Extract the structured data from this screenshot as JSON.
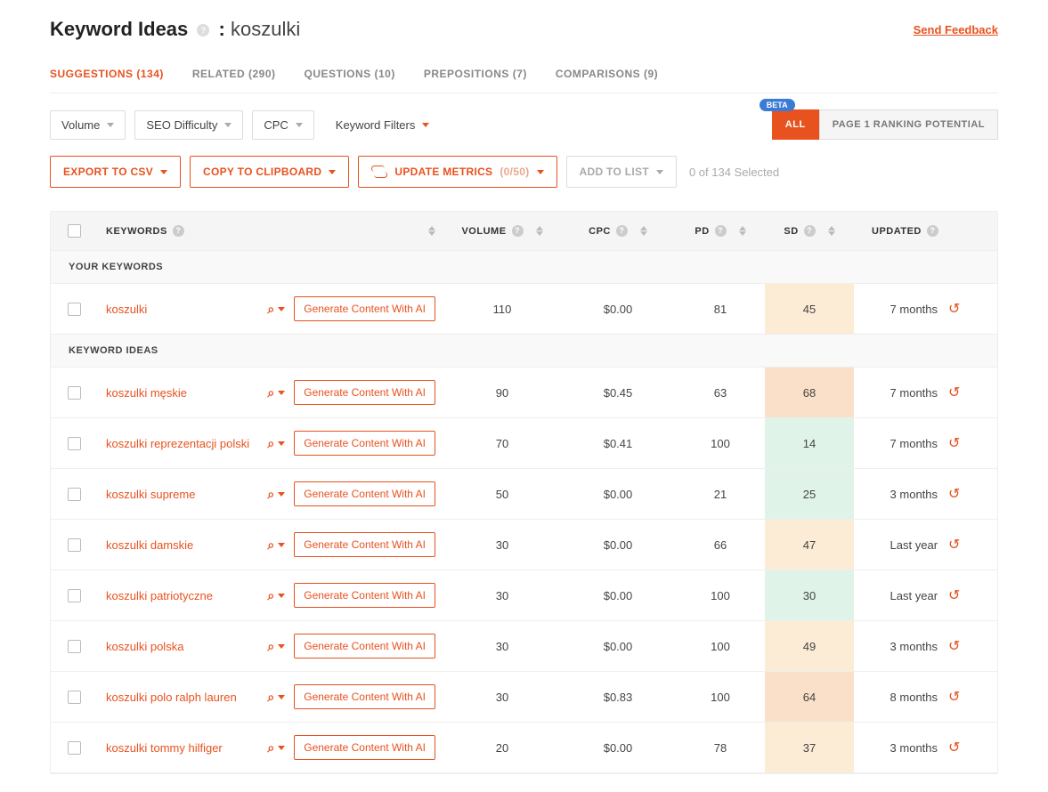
{
  "header": {
    "title_prefix": "Keyword Ideas",
    "keyword": "koszulki",
    "feedback": "Send Feedback"
  },
  "tabs": [
    {
      "label": "SUGGESTIONS (134)",
      "active": true
    },
    {
      "label": "RELATED (290)",
      "active": false
    },
    {
      "label": "QUESTIONS (10)",
      "active": false
    },
    {
      "label": "PREPOSITIONS (7)",
      "active": false
    },
    {
      "label": "COMPARISONS (9)",
      "active": false
    }
  ],
  "filters": {
    "volume": "Volume",
    "seo": "SEO Difficulty",
    "cpc": "CPC",
    "kw_filters": "Keyword Filters",
    "beta": "BETA",
    "all": "ALL",
    "potential": "PAGE 1 RANKING POTENTIAL"
  },
  "actions": {
    "export": "EXPORT TO CSV",
    "copy": "COPY TO CLIPBOARD",
    "update_prefix": "UPDATE METRICS",
    "update_count": "(0/50)",
    "add": "ADD TO LIST",
    "selected": "0 of 134 Selected"
  },
  "columns": {
    "keywords": "KEYWORDS",
    "volume": "VOLUME",
    "cpc": "CPC",
    "pd": "PD",
    "sd": "SD",
    "updated": "UPDATED"
  },
  "sections": {
    "your": "YOUR KEYWORDS",
    "ideas": "KEYWORD IDEAS"
  },
  "gen_label": "Generate Content With AI",
  "rows_your": [
    {
      "kw": "koszulki",
      "vol": "110",
      "cpc": "$0.00",
      "pd": "81",
      "sd": "45",
      "sd_color": "sd-yellow",
      "updated": "7 months"
    }
  ],
  "rows_ideas": [
    {
      "kw": "koszulki męskie",
      "vol": "90",
      "cpc": "$0.45",
      "pd": "63",
      "sd": "68",
      "sd_color": "sd-orange",
      "updated": "7 months"
    },
    {
      "kw": "koszulki reprezentacji polski",
      "vol": "70",
      "cpc": "$0.41",
      "pd": "100",
      "sd": "14",
      "sd_color": "sd-green",
      "updated": "7 months"
    },
    {
      "kw": "koszulki supreme",
      "vol": "50",
      "cpc": "$0.00",
      "pd": "21",
      "sd": "25",
      "sd_color": "sd-green",
      "updated": "3 months"
    },
    {
      "kw": "koszulki damskie",
      "vol": "30",
      "cpc": "$0.00",
      "pd": "66",
      "sd": "47",
      "sd_color": "sd-yellow",
      "updated": "Last year"
    },
    {
      "kw": "koszulki patriotyczne",
      "vol": "30",
      "cpc": "$0.00",
      "pd": "100",
      "sd": "30",
      "sd_color": "sd-green",
      "updated": "Last year"
    },
    {
      "kw": "koszulki polska",
      "vol": "30",
      "cpc": "$0.00",
      "pd": "100",
      "sd": "49",
      "sd_color": "sd-yellow",
      "updated": "3 months"
    },
    {
      "kw": "koszulki polo ralph lauren",
      "vol": "30",
      "cpc": "$0.83",
      "pd": "100",
      "sd": "64",
      "sd_color": "sd-orange",
      "updated": "8 months"
    },
    {
      "kw": "koszulki tommy hilfiger",
      "vol": "20",
      "cpc": "$0.00",
      "pd": "78",
      "sd": "37",
      "sd_color": "sd-yellow",
      "updated": "3 months"
    }
  ]
}
